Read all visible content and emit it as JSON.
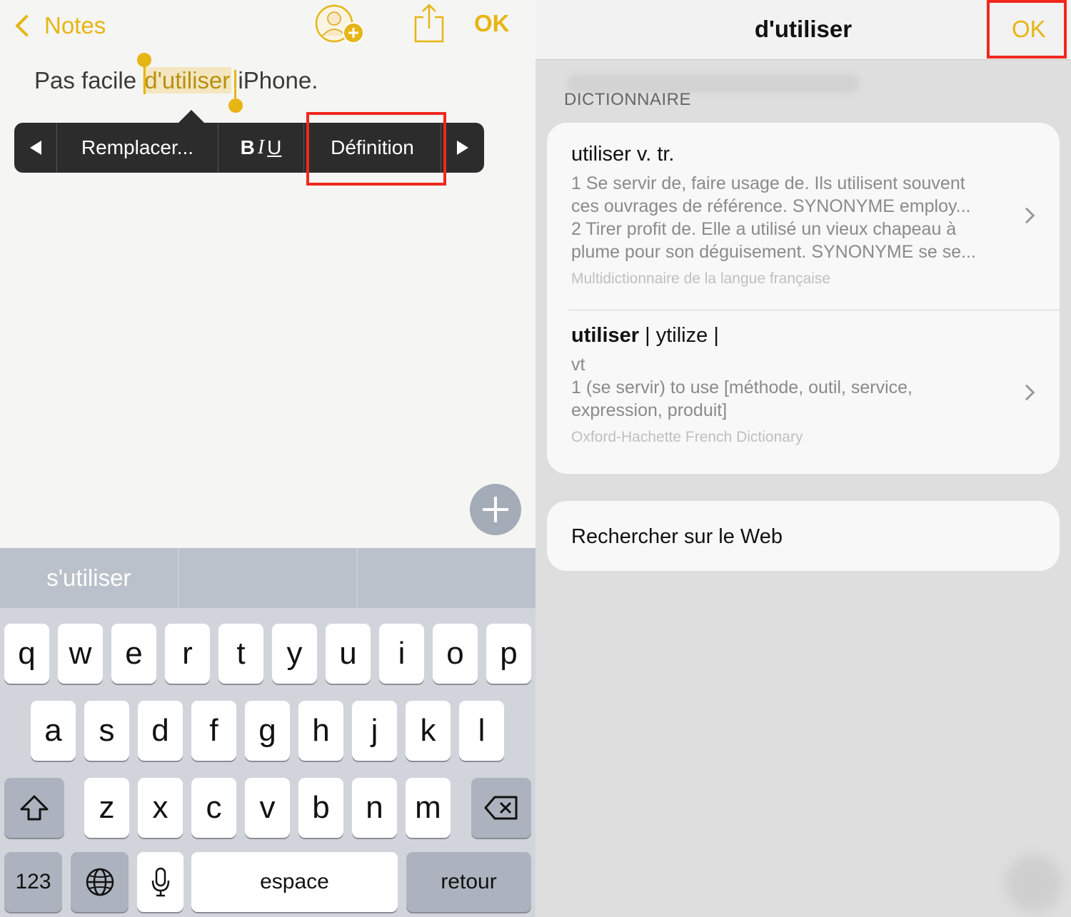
{
  "left": {
    "nav": {
      "back_label": "Notes",
      "ok_label": "OK"
    },
    "note": {
      "before": "Pas facile ",
      "selected": "d'utiliser",
      "after": " iPhone."
    },
    "edit_menu": {
      "replace": "Remplacer...",
      "definition": "Définition"
    },
    "keyboard": {
      "suggestions": [
        "s'utiliser",
        "",
        ""
      ],
      "row1": [
        "q",
        "w",
        "e",
        "r",
        "t",
        "y",
        "u",
        "i",
        "o",
        "p"
      ],
      "row2": [
        "a",
        "s",
        "d",
        "f",
        "g",
        "h",
        "j",
        "k",
        "l"
      ],
      "row3": [
        "z",
        "x",
        "c",
        "v",
        "b",
        "n",
        "m"
      ],
      "numbers_label": "123",
      "space_label": "espace",
      "return_label": "retour"
    }
  },
  "right": {
    "title": "d'utiliser",
    "ok_label": "OK",
    "section_label": "DICTIONNAIRE",
    "entries": [
      {
        "head": "utiliser v. tr.",
        "lines": [
          "1 Se servir de, faire usage de. Ils utilisent souvent",
          "ces ouvrages de référence. SYNONYME employ...",
          "2 Tirer profit de. Elle a utilisé un vieux chapeau à",
          "plume pour son déguisement. SYNONYME se se..."
        ],
        "source": "Multidictionnaire de la langue française"
      },
      {
        "head_bold": "utiliser",
        "head_rest": " | ytilize |",
        "lines": [
          "vt",
          "1 (se servir) to use [méthode, outil, service,",
          "expression, produit]"
        ],
        "source": "Oxford-Hachette French Dictionary"
      }
    ],
    "web_search_label": "Rechercher sur le Web"
  },
  "colors": {
    "accent": "#e7b514",
    "highlight_box": "#f0281e",
    "menu_bg": "#2c2c2c"
  }
}
